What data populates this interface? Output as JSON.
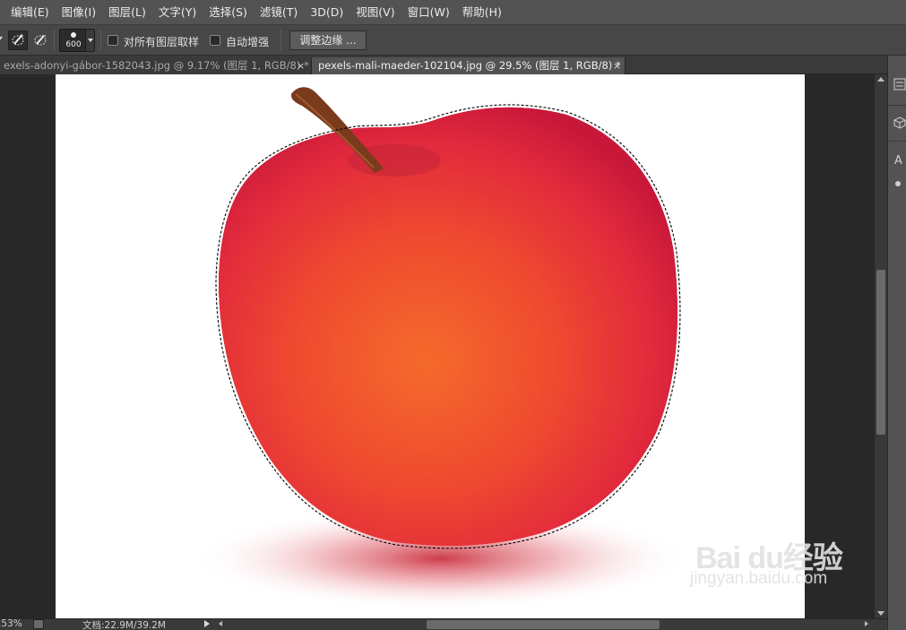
{
  "menu": [
    "编辑(E)",
    "图像(I)",
    "图层(L)",
    "文字(Y)",
    "选择(S)",
    "滤镜(T)",
    "3D(D)",
    "视图(V)",
    "窗口(W)",
    "帮助(H)"
  ],
  "options": {
    "brush_size": "600",
    "sample_all_layers_label": "对所有图层取样",
    "auto_enhance_label": "自动增强",
    "refine_edge_label": "调整边缘 ..."
  },
  "tabs": [
    {
      "label": "exels-adonyi-gábor-1582043.jpg @ 9.17% (图层 1, RGB/8) *",
      "close": "×",
      "active": false
    },
    {
      "label": "pexels-mali-maeder-102104.jpg @ 29.5% (图层 1, RGB/8) *",
      "close": "×",
      "active": true
    }
  ],
  "panel": {
    "letter": "A"
  },
  "status": {
    "zoom": ".53%",
    "doc": "文档:22.9M/39.2M"
  },
  "watermark": {
    "logo": "Bai du经验",
    "sub": "jingyan.baidu.com"
  },
  "colors": {
    "apple_red": "#e8233a",
    "apple_orange": "#f3632a",
    "stem": "#7a3a1c"
  }
}
